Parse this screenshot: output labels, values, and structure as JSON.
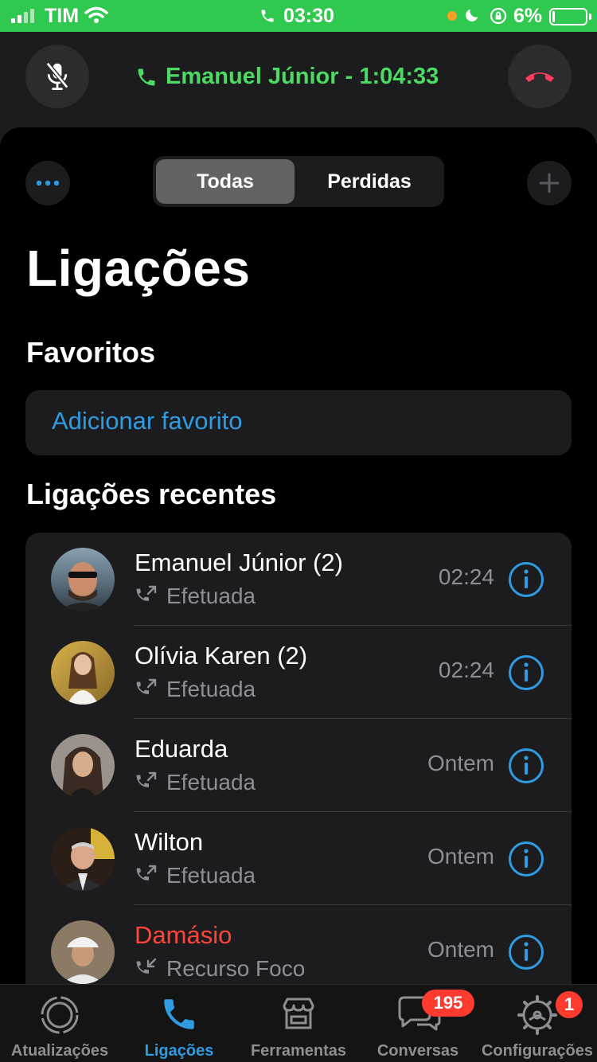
{
  "status_bar": {
    "carrier": "TIM",
    "time": "03:30",
    "battery_pct": "6%",
    "battery_level": 0.06
  },
  "call_banner": {
    "text": "Emanuel Júnior - 1:04:33"
  },
  "segments": [
    "Todas",
    "Perdidas"
  ],
  "page_title": "Ligações",
  "favorites": {
    "title": "Favoritos",
    "add_link": "Adicionar favorito"
  },
  "recent": {
    "title": "Ligações recentes",
    "items": [
      {
        "name": "Emanuel Júnior (2)",
        "type": "Efetuada",
        "time": "02:24",
        "missed": false,
        "direction": "outgoing"
      },
      {
        "name": "Olívia Karen (2)",
        "type": "Efetuada",
        "time": "02:24",
        "missed": false,
        "direction": "outgoing"
      },
      {
        "name": "Eduarda",
        "type": "Efetuada",
        "time": "Ontem",
        "missed": false,
        "direction": "outgoing"
      },
      {
        "name": "Wilton",
        "type": "Efetuada",
        "time": "Ontem",
        "missed": false,
        "direction": "outgoing"
      },
      {
        "name": "Damásio",
        "type": "Recurso Foco",
        "time": "Ontem",
        "missed": true,
        "direction": "incoming"
      }
    ]
  },
  "tab_bar": {
    "tabs": [
      {
        "label": "Atualizações",
        "icon": "status-icon",
        "active": false
      },
      {
        "label": "Ligações",
        "icon": "phone-icon",
        "active": true
      },
      {
        "label": "Ferramentas",
        "icon": "store-icon",
        "active": false
      },
      {
        "label": "Conversas",
        "icon": "chat-icon",
        "active": false,
        "badge": "195"
      },
      {
        "label": "Configurações",
        "icon": "gear-icon",
        "active": false,
        "badge": "1"
      }
    ]
  },
  "colors": {
    "status_green": "#30c94f",
    "call_green": "#4cd964",
    "accent_blue": "#2f9be3",
    "missed_red": "#ff453a",
    "end_call_red": "#ff3b5c"
  }
}
